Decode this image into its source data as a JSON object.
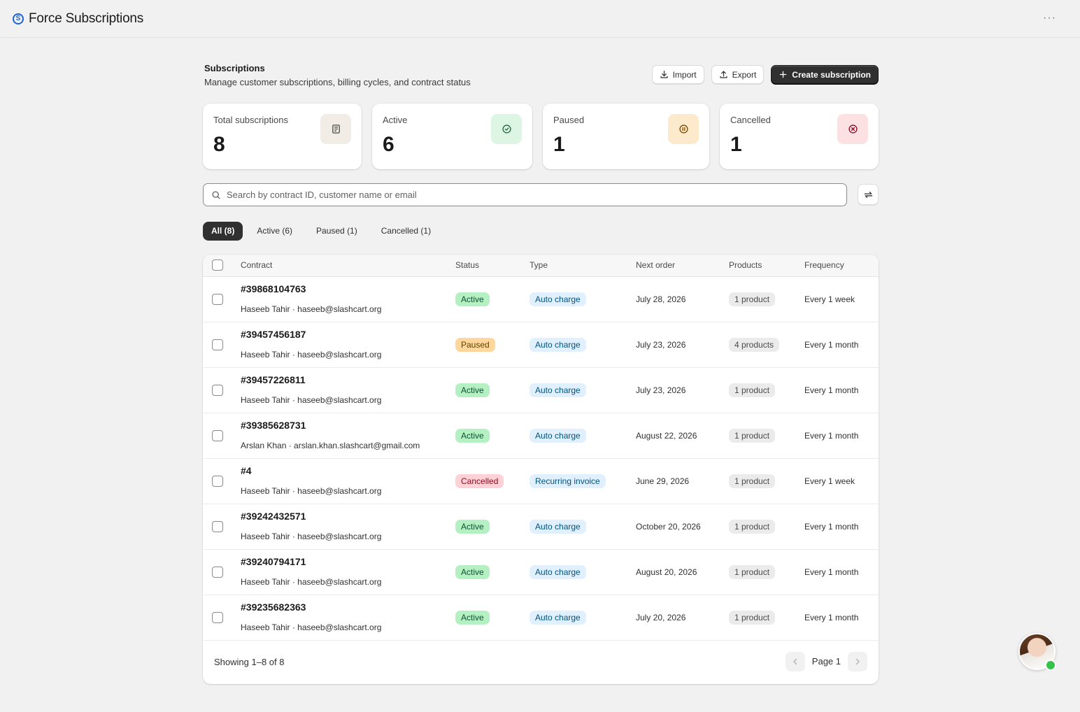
{
  "app": {
    "title": "Force Subscriptions",
    "logo_letter": "S",
    "more": "···"
  },
  "page": {
    "title": "Subscriptions",
    "subtitle": "Manage customer subscriptions, billing cycles, and contract status",
    "import_label": "Import",
    "export_label": "Export",
    "create_label": "Create subscription"
  },
  "stats": [
    {
      "label": "Total subscriptions",
      "value": "8",
      "icon": "document-icon",
      "icon_bg": "#f1ede6"
    },
    {
      "label": "Active",
      "value": "6",
      "icon": "check-circle-icon",
      "icon_bg": "#ddf6e4"
    },
    {
      "label": "Paused",
      "value": "1",
      "icon": "pause-circle-icon",
      "icon_bg": "#fde9cc"
    },
    {
      "label": "Cancelled",
      "value": "1",
      "icon": "x-circle-icon",
      "icon_bg": "#fde0e2"
    }
  ],
  "search": {
    "placeholder": "Search by contract ID, customer name or email"
  },
  "tabs": [
    {
      "label": "All (8)",
      "active": true
    },
    {
      "label": "Active (6)",
      "active": false
    },
    {
      "label": "Paused (1)",
      "active": false
    },
    {
      "label": "Cancelled (1)",
      "active": false
    }
  ],
  "table": {
    "headers": {
      "contract": "Contract",
      "status": "Status",
      "type": "Type",
      "next_order": "Next order",
      "products": "Products",
      "frequency": "Frequency"
    },
    "rows": [
      {
        "id": "#39868104763",
        "meta": "Haseeb Tahir · haseeb@slashcart.org",
        "status": "Active",
        "type": "Auto charge",
        "next": "July 28, 2026",
        "products": "1 product",
        "freq": "Every 1 week"
      },
      {
        "id": "#39457456187",
        "meta": "Haseeb Tahir · haseeb@slashcart.org",
        "status": "Paused",
        "type": "Auto charge",
        "next": "July 23, 2026",
        "products": "4 products",
        "freq": "Every 1 month"
      },
      {
        "id": "#39457226811",
        "meta": "Haseeb Tahir · haseeb@slashcart.org",
        "status": "Active",
        "type": "Auto charge",
        "next": "July 23, 2026",
        "products": "1 product",
        "freq": "Every 1 month"
      },
      {
        "id": "#39385628731",
        "meta": "Arslan Khan · arslan.khan.slashcart@gmail.com",
        "status": "Active",
        "type": "Auto charge",
        "next": "August 22, 2026",
        "products": "1 product",
        "freq": "Every 1 month"
      },
      {
        "id": "#4",
        "meta": "Haseeb Tahir · haseeb@slashcart.org",
        "status": "Cancelled",
        "type": "Recurring invoice",
        "next": "June 29, 2026",
        "products": "1 product",
        "freq": "Every 1 week"
      },
      {
        "id": "#39242432571",
        "meta": "Haseeb Tahir · haseeb@slashcart.org",
        "status": "Active",
        "type": "Auto charge",
        "next": "October 20, 2026",
        "products": "1 product",
        "freq": "Every 1 month"
      },
      {
        "id": "#39240794171",
        "meta": "Haseeb Tahir · haseeb@slashcart.org",
        "status": "Active",
        "type": "Auto charge",
        "next": "August 20, 2026",
        "products": "1 product",
        "freq": "Every 1 month"
      },
      {
        "id": "#39235682363",
        "meta": "Haseeb Tahir · haseeb@slashcart.org",
        "status": "Active",
        "type": "Auto charge",
        "next": "July 20, 2026",
        "products": "1 product",
        "freq": "Every 1 month"
      }
    ]
  },
  "footer": {
    "showing": "Showing 1–8 of 8",
    "page_label": "Page 1"
  }
}
